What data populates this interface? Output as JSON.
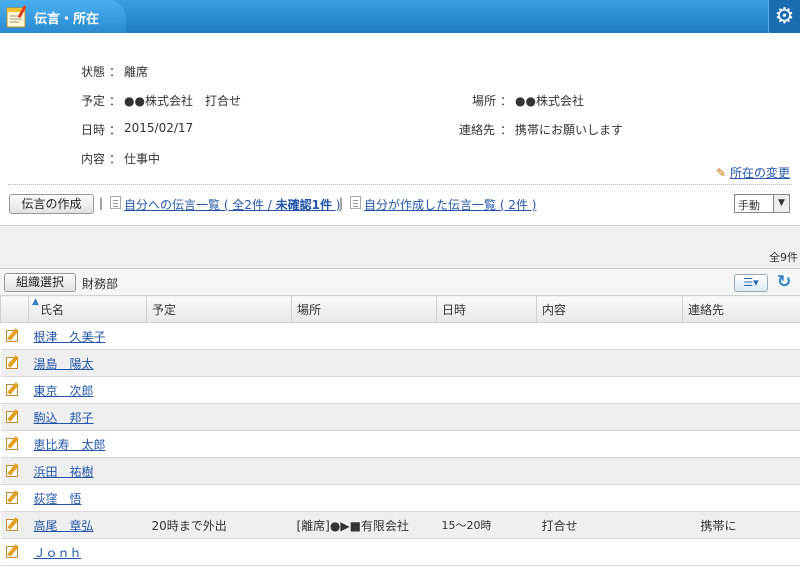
{
  "header": {
    "title": "伝言・所在",
    "settings_icon": "gear-icon"
  },
  "status": {
    "state_label": "状態",
    "state_value": "離席",
    "schedule_label": "予定",
    "schedule_value": "●●株式会社　打合せ",
    "place_label": "場所",
    "place_value": "●●株式会社",
    "datetime_label": "日時",
    "datetime_value": "2015/02/17",
    "contact_label": "連絡先",
    "contact_value": "携帯にお願いします",
    "content_label": "内容",
    "content_value": "仕事中",
    "colon": "：",
    "change_link": "所在の変更"
  },
  "actions": {
    "create_button": "伝言の作成",
    "pipe": "|",
    "inbox_link": "自分への伝言一覧 ( 全2件 / ",
    "inbox_unconfirmed": "未確認1件",
    "inbox_close": " )",
    "sent_link": "自分が作成した伝言一覧 ( 2件 )",
    "mode_value": "手動"
  },
  "list": {
    "total": "全9件",
    "org_button": "組織選択",
    "dept": "財務部",
    "columns": [
      "氏名",
      "予定",
      "場所",
      "日時",
      "内容",
      "連絡先"
    ],
    "rows": [
      {
        "name": "根津　久美子",
        "schedule": "",
        "place": "",
        "datetime": "",
        "content": "",
        "contact": ""
      },
      {
        "name": "湯島　陽太",
        "schedule": "",
        "place": "",
        "datetime": "",
        "content": "",
        "contact": ""
      },
      {
        "name": "東京　次郎",
        "schedule": "",
        "place": "",
        "datetime": "",
        "content": "",
        "contact": ""
      },
      {
        "name": "駒込　邦子",
        "schedule": "",
        "place": "",
        "datetime": "",
        "content": "",
        "contact": ""
      },
      {
        "name": "恵比寿　太郎",
        "schedule": "",
        "place": "",
        "datetime": "",
        "content": "",
        "contact": ""
      },
      {
        "name": "浜田　祐樹",
        "schedule": "",
        "place": "",
        "datetime": "",
        "content": "",
        "contact": ""
      },
      {
        "name": "荻窪　悟",
        "schedule": "",
        "place": "",
        "datetime": "",
        "content": "",
        "contact": ""
      },
      {
        "name": "高尾　章弘",
        "schedule": "20時まで外出",
        "place": "[離席]●▶■有限会社",
        "datetime": "15～20時",
        "content": "打合せ",
        "contact": "携帯に"
      },
      {
        "name": "Ｊｏｎｈ",
        "schedule": "",
        "place": "",
        "datetime": "",
        "content": "",
        "contact": ""
      }
    ]
  },
  "colors": {
    "header_blue": "#1f7cc4",
    "link_blue": "#2255aa"
  }
}
